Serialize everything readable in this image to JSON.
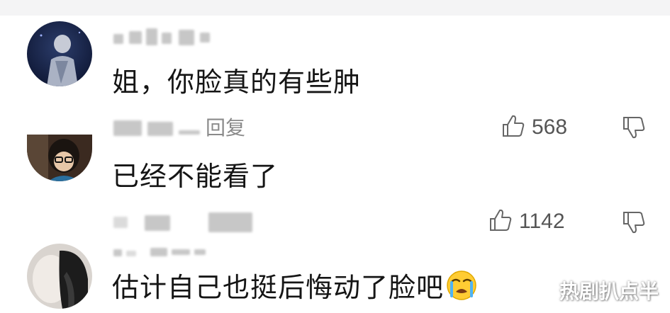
{
  "comments": [
    {
      "text": "姐，你脸真的有些肿",
      "reply_label": "回复",
      "likes": "568"
    },
    {
      "text": "已经不能看了",
      "likes": "1142"
    },
    {
      "text": "估计自己也挺后悔动了脸吧",
      "emoji": "loudly-crying-face"
    }
  ],
  "watermark": "热剧扒点半",
  "colors": {
    "text": "#151515",
    "meta": "#8a8a8a",
    "icon": "#666666"
  }
}
